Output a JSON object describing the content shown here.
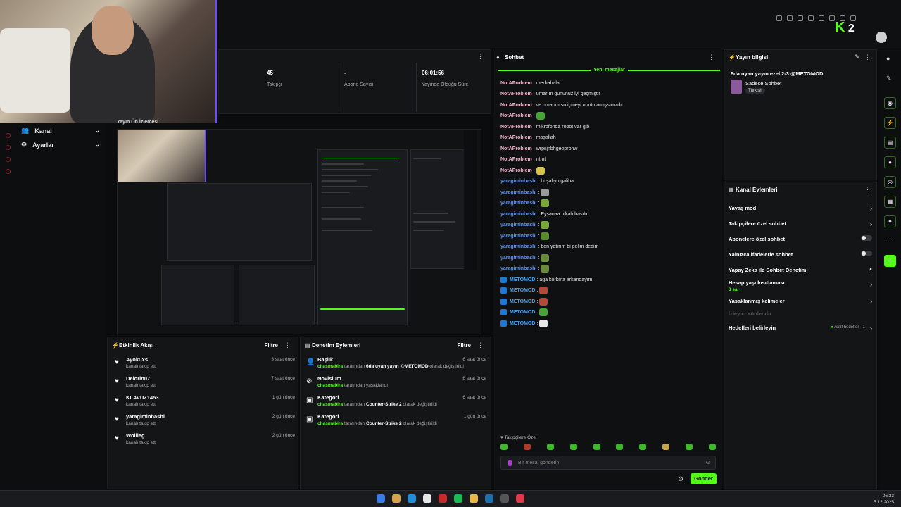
{
  "stats": [
    {
      "value": "45",
      "label": "Takipçi"
    },
    {
      "value": "-",
      "label": "Abone Sayısı"
    },
    {
      "value": "06:01:56",
      "label": "Yayında Olduğu Süre"
    }
  ],
  "leftnav": {
    "kanal": "Kanal",
    "ayarlar": "Ayarlar"
  },
  "preview": {
    "title": "Yayın Ön İzlemesi"
  },
  "activity": {
    "title": "Etkinlik Akışı",
    "filter": "Filtre",
    "items": [
      {
        "name": "Ayokuxs",
        "sub": "kanalı takip etti",
        "time": "3 saat önce"
      },
      {
        "name": "Delorin07",
        "sub": "kanalı takip etti",
        "time": "7 saat önce"
      },
      {
        "name": "KLAVUZ1453",
        "sub": "kanalı takip etti",
        "time": "1 gün önce"
      },
      {
        "name": "yaragiminbashi",
        "sub": "kanalı takip etti",
        "time": "2 gün önce"
      },
      {
        "name": "Wolileg",
        "sub": "kanalı takip etti",
        "time": "2 gün önce"
      }
    ]
  },
  "moderation": {
    "title": "Denetim Eylemleri",
    "filter": "Filtre",
    "items": [
      {
        "name": "Başlık",
        "user": "chasmabira",
        "mid": " tarafından ",
        "value": "6da uyan yayın @METOMOD",
        "end": " olarak değiştirildi",
        "time": "6 saat önce"
      },
      {
        "name": "Novisium",
        "user": "chasmabira",
        "mid": " tarafından yasaklandı",
        "value": "",
        "end": "",
        "time": "6 saat önce"
      },
      {
        "name": "Kategori",
        "user": "chasmabira",
        "mid": " tarafından ",
        "value": "Counter-Strike 2",
        "end": " olarak değiştirildi",
        "time": "6 saat önce"
      },
      {
        "name": "Kategori",
        "user": "chasmabira",
        "mid": " tarafından ",
        "value": "Counter-Strike 2",
        "end": " olarak değiştirildi",
        "time": "1 gün önce"
      }
    ]
  },
  "chat": {
    "title": "Sohbet",
    "new_messages": "Yeni mesajlar",
    "messages": [
      {
        "user": "NotAProblem",
        "color": "#f3b3c9",
        "text": "merhabalar",
        "emote": ""
      },
      {
        "user": "NotAProblem",
        "color": "#f3b3c9",
        "text": "umarım gününüz iyi geçmiştir",
        "emote": ""
      },
      {
        "user": "NotAProblem",
        "color": "#f3b3c9",
        "text": "ve umarım su içmeyi unutmamışsınızdır",
        "emote": ""
      },
      {
        "user": "NotAProblem",
        "color": "#f3b3c9",
        "text": "",
        "emote": "#4aa338"
      },
      {
        "user": "NotAProblem",
        "color": "#f3b3c9",
        "text": "mikrofonda robot var gib",
        "emote": ""
      },
      {
        "user": "NotAProblem",
        "color": "#f3b3c9",
        "text": "maşallah",
        "emote": ""
      },
      {
        "user": "NotAProblem",
        "color": "#f3b3c9",
        "text": "wrpsjnbhgeoprphw",
        "emote": ""
      },
      {
        "user": "NotAProblem",
        "color": "#f3b3c9",
        "text": "nt nt",
        "emote": ""
      },
      {
        "user": "NotAProblem",
        "color": "#f3b3c9",
        "text": "",
        "emote": "#d6c14a"
      },
      {
        "user": "yaragiminbashi",
        "color": "#5b8ff0",
        "text": "boşalıyo galiba",
        "emote": ""
      },
      {
        "user": "yaragiminbashi",
        "color": "#5b8ff0",
        "text": "",
        "emote": "#9a9a9a"
      },
      {
        "user": "yaragiminbashi",
        "color": "#5b8ff0",
        "text": "",
        "emote": "#7aa53a"
      },
      {
        "user": "yaragiminbashi",
        "color": "#5b8ff0",
        "text": "Eyşanaa nikah basılır",
        "emote": ""
      },
      {
        "user": "yaragiminbashi",
        "color": "#5b8ff0",
        "text": "",
        "emote": "#7aa53a"
      },
      {
        "user": "yaragiminbashi",
        "color": "#5b8ff0",
        "text": "",
        "emote": "#5a8a2e"
      },
      {
        "user": "yaragiminbashi",
        "color": "#5b8ff0",
        "text": "ben yatırım bi gelim dedim",
        "emote": ""
      },
      {
        "user": "yaragiminbashi",
        "color": "#5b8ff0",
        "text": "",
        "emote": "#6a8a3e"
      },
      {
        "user": "yaragiminbashi",
        "color": "#5b8ff0",
        "text": "",
        "emote": "#6a8a3e"
      },
      {
        "user": "METOMOD",
        "color": "#4aa3f0",
        "text": "aga korkma arkandayım",
        "emote": "",
        "badge": true
      },
      {
        "user": "METOMOD",
        "color": "#4aa3f0",
        "text": "",
        "emote": "#b14a3a",
        "badge": true
      },
      {
        "user": "METOMOD",
        "color": "#4aa3f0",
        "text": "",
        "emote": "#b14a3a",
        "badge": true
      },
      {
        "user": "METOMOD",
        "color": "#4aa3f0",
        "text": "",
        "emote": "#4aa338",
        "badge": true
      },
      {
        "user": "METOMOD",
        "color": "#4aa3f0",
        "text": "",
        "emote": "#e8e8e8",
        "badge": true
      }
    ],
    "followers_only": "Takipçilere Özel",
    "placeholder": "Bir mesaj gönderin",
    "send": "Gönder"
  },
  "stream_info": {
    "title": "Yayın bilgisi",
    "stream_title": "6da uyan yayın ezel 2-3 @METOMOD",
    "category": "Sadece Sohbet",
    "language": "Türkish"
  },
  "channel_actions": {
    "title": "Kanal Eylemleri",
    "slow_mode": "Yavaş mod",
    "followers_chat": "Takipçilere özel sohbet",
    "subs_chat": "Abonelere özel sohbet",
    "emotes_chat": "Yalnızca ifadelerle sohbet",
    "ai_mod": "Yapay Zeka ile Sohbet Denetimi",
    "age_limit": "Hesap yaşı kısıtlaması",
    "age_value": "3 sa.",
    "banned_words": "Yasaklanmış kelimeler",
    "redirect": "İzleyici Yönlendir",
    "goals": "Hedefleri belirleyin",
    "goals_status": "Aktif hedefler - 1"
  },
  "clock": {
    "time": "06:33",
    "date": "5.12.2025"
  },
  "colors": {
    "accent": "#53fc18",
    "bg": "#0b0c0d",
    "panel": "#141517"
  }
}
